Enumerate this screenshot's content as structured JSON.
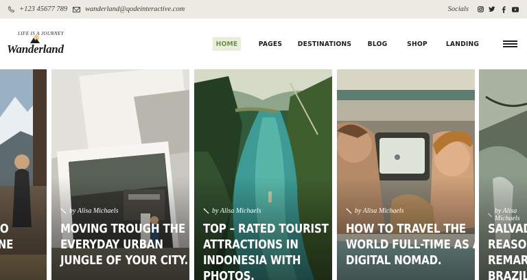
{
  "topbar": {
    "phone": "+123 45677 789",
    "email": "wanderland@qodeinteractive.com",
    "socials_label": "Socials",
    "social_icons": [
      "instagram-icon",
      "twitter-icon",
      "facebook-icon",
      "youtube-icon"
    ]
  },
  "logo": {
    "tagline": "LIFE IS A JOURNEY",
    "name": "Wanderland"
  },
  "nav": {
    "items": [
      {
        "label": "HOME",
        "active": true
      },
      {
        "label": "PAGES",
        "active": false
      },
      {
        "label": "DESTINATIONS",
        "active": false
      },
      {
        "label": "BLOG",
        "active": false
      },
      {
        "label": "SHOP",
        "active": false
      },
      {
        "label": "LANDING",
        "active": false
      }
    ],
    "menu_icon": "hamburger-icon",
    "accent_color": "#6f8c55",
    "active_bg_color": "#e9edd9"
  },
  "slider": {
    "cards": [
      {
        "byline": "",
        "title_lines": [
          "S TO",
          "TONE",
          ""
        ]
      },
      {
        "byline": "by Alisa Michaels",
        "title_lines": [
          "MOVING TROUGH THE",
          "EVERYDAY URBAN",
          "JUNGLE OF YOUR CITY."
        ]
      },
      {
        "byline": "by Alisa Michaels",
        "title_lines": [
          "TOP – RATED TOURIST",
          "ATTRACTIONS IN",
          "INDONESIA WITH",
          "PHOTOS."
        ]
      },
      {
        "byline": "by Alisa Michaels",
        "title_lines": [
          "HOW TO TRAVEL THE",
          "WORLD FULL-TIME AS A",
          "DIGITAL NOMAD."
        ]
      },
      {
        "byline": "by Alisa Michaels",
        "title_lines": [
          "SALVAD",
          "REASON",
          "REMARK",
          "BRAZILI"
        ]
      }
    ]
  }
}
